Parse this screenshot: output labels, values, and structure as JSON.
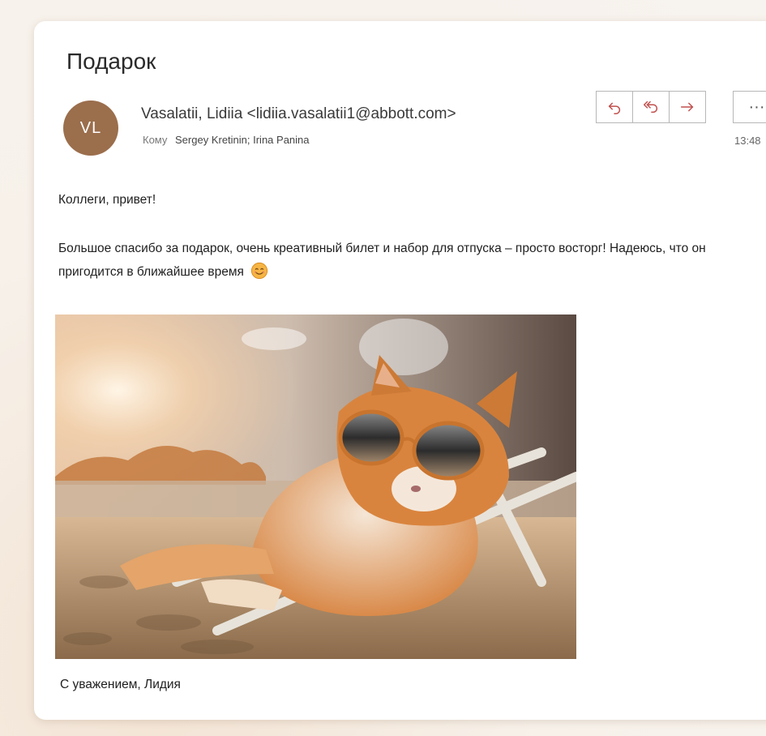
{
  "email": {
    "subject": "Подарок",
    "avatar_initials": "VL",
    "avatar_color": "#9b6e4c",
    "sender": "Vasalatii, Lidiia <lidiia.vasalatii1@abbott.com>",
    "to_label": "Кому",
    "recipients": "Sergey Kretinin; Irina Panina",
    "time": "13:48",
    "greeting": "Коллеги, привет!",
    "body": "Большое спасибо за подарок, очень креативный билет и набор для отпуска – просто восторг! Надеюсь, что он пригодится в ближайшее время",
    "signature": "С уважением, Лидия",
    "accent_color": "#c0504d"
  },
  "toolbar": {
    "reply_icon": "reply-icon",
    "reply_all_icon": "reply-all-icon",
    "forward_icon": "forward-icon",
    "more_label": "···"
  }
}
